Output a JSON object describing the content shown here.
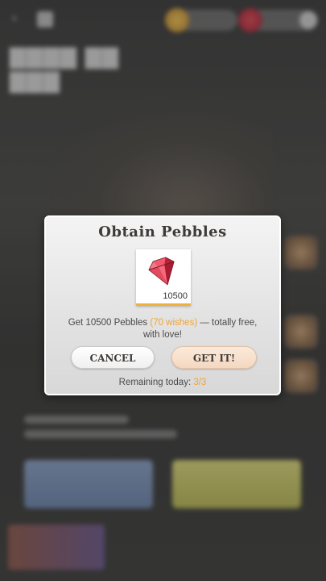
{
  "dialog": {
    "title": "Obtain Pebbles",
    "item": {
      "icon": "ruby-gem-icon",
      "quantity": "10500"
    },
    "description": {
      "prefix": "Get 10500 Pebbles ",
      "highlight": "(70 wishes)",
      "suffix": " — totally free, with love!"
    },
    "buttons": {
      "cancel_label": "CANCEL",
      "confirm_label": "GET IT!"
    },
    "remaining": {
      "label": "Remaining today: ",
      "value": "3/3"
    }
  },
  "colors": {
    "accent": "#f0a43a",
    "gem": "#d8324a",
    "confirm_button": "#f4d8c0",
    "title_text": "#3e3a38"
  }
}
